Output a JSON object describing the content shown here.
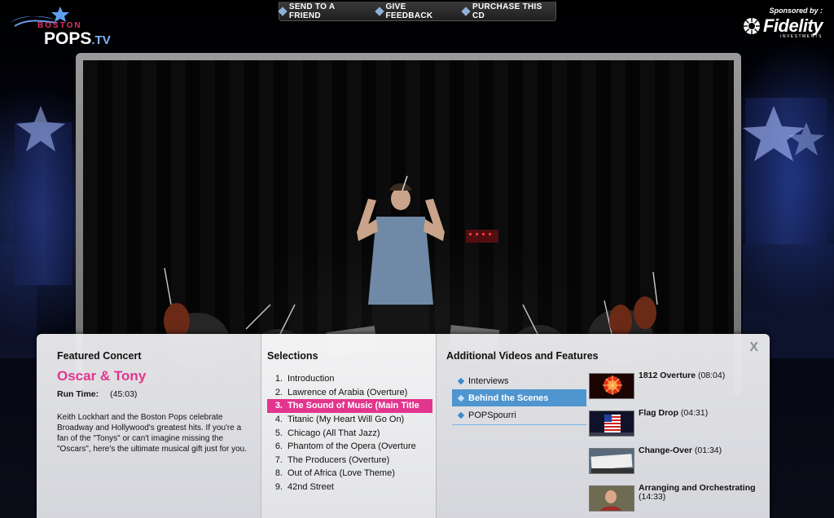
{
  "brand": {
    "boston": "BOSTON",
    "pops": "POPS",
    "tv": ".TV"
  },
  "nav": [
    {
      "label": "SEND TO A FRIEND"
    },
    {
      "label": "GIVE FEEDBACK"
    },
    {
      "label": "PURCHASE THIS CD"
    }
  ],
  "sponsor": {
    "by": "Sponsored by :",
    "name": "Fidelity",
    "sub": "INVESTMENTS"
  },
  "featured": {
    "heading": "Featured Concert",
    "title": "Oscar & Tony",
    "runtime_label": "Run Time:",
    "runtime_value": "(45:03)",
    "description": "Keith Lockhart and the Boston Pops celebrate Broadway and Hollywood's greatest hits. If you're a fan of the \"Tonys\" or can't imagine missing the \"Oscars\", here's the ultimate musical gift just for you."
  },
  "selections": {
    "heading": "Selections",
    "items": [
      {
        "num": "1.",
        "label": "Introduction"
      },
      {
        "num": "2.",
        "label": "Lawrence of Arabia (Overture)"
      },
      {
        "num": "3.",
        "label": "The Sound of Music (Main Title"
      },
      {
        "num": "4.",
        "label": "Titanic (My Heart Will Go On)"
      },
      {
        "num": "5.",
        "label": "Chicago (All That Jazz)"
      },
      {
        "num": "6.",
        "label": "Phantom of the Opera (Overture"
      },
      {
        "num": "7.",
        "label": "The Producers (Overture)"
      },
      {
        "num": "8.",
        "label": "Out of Africa (Love Theme)"
      },
      {
        "num": "9.",
        "label": "42nd Street"
      }
    ],
    "active_index": 2
  },
  "additional": {
    "heading": "Additional Videos and Features",
    "close_label": "X",
    "categories": [
      {
        "label": "Interviews"
      },
      {
        "label": "Behind the Scenes"
      },
      {
        "label": "POPSpourri"
      }
    ],
    "active_category": 1,
    "videos": [
      {
        "title": "1812 Overture",
        "duration": "(08:04)",
        "thumb": "fireworks"
      },
      {
        "title": "Flag Drop",
        "duration": "(04:31)",
        "thumb": "flag"
      },
      {
        "title": "Change-Over",
        "duration": "(01:34)",
        "thumb": "pops-sign"
      },
      {
        "title": "Arranging and Orchestrating",
        "duration": "(14:33)",
        "thumb": "portrait"
      }
    ]
  },
  "colors": {
    "accent_pink": "#e2358e",
    "accent_blue": "#4f95cf",
    "brand_blue": "#7fb4ff"
  }
}
